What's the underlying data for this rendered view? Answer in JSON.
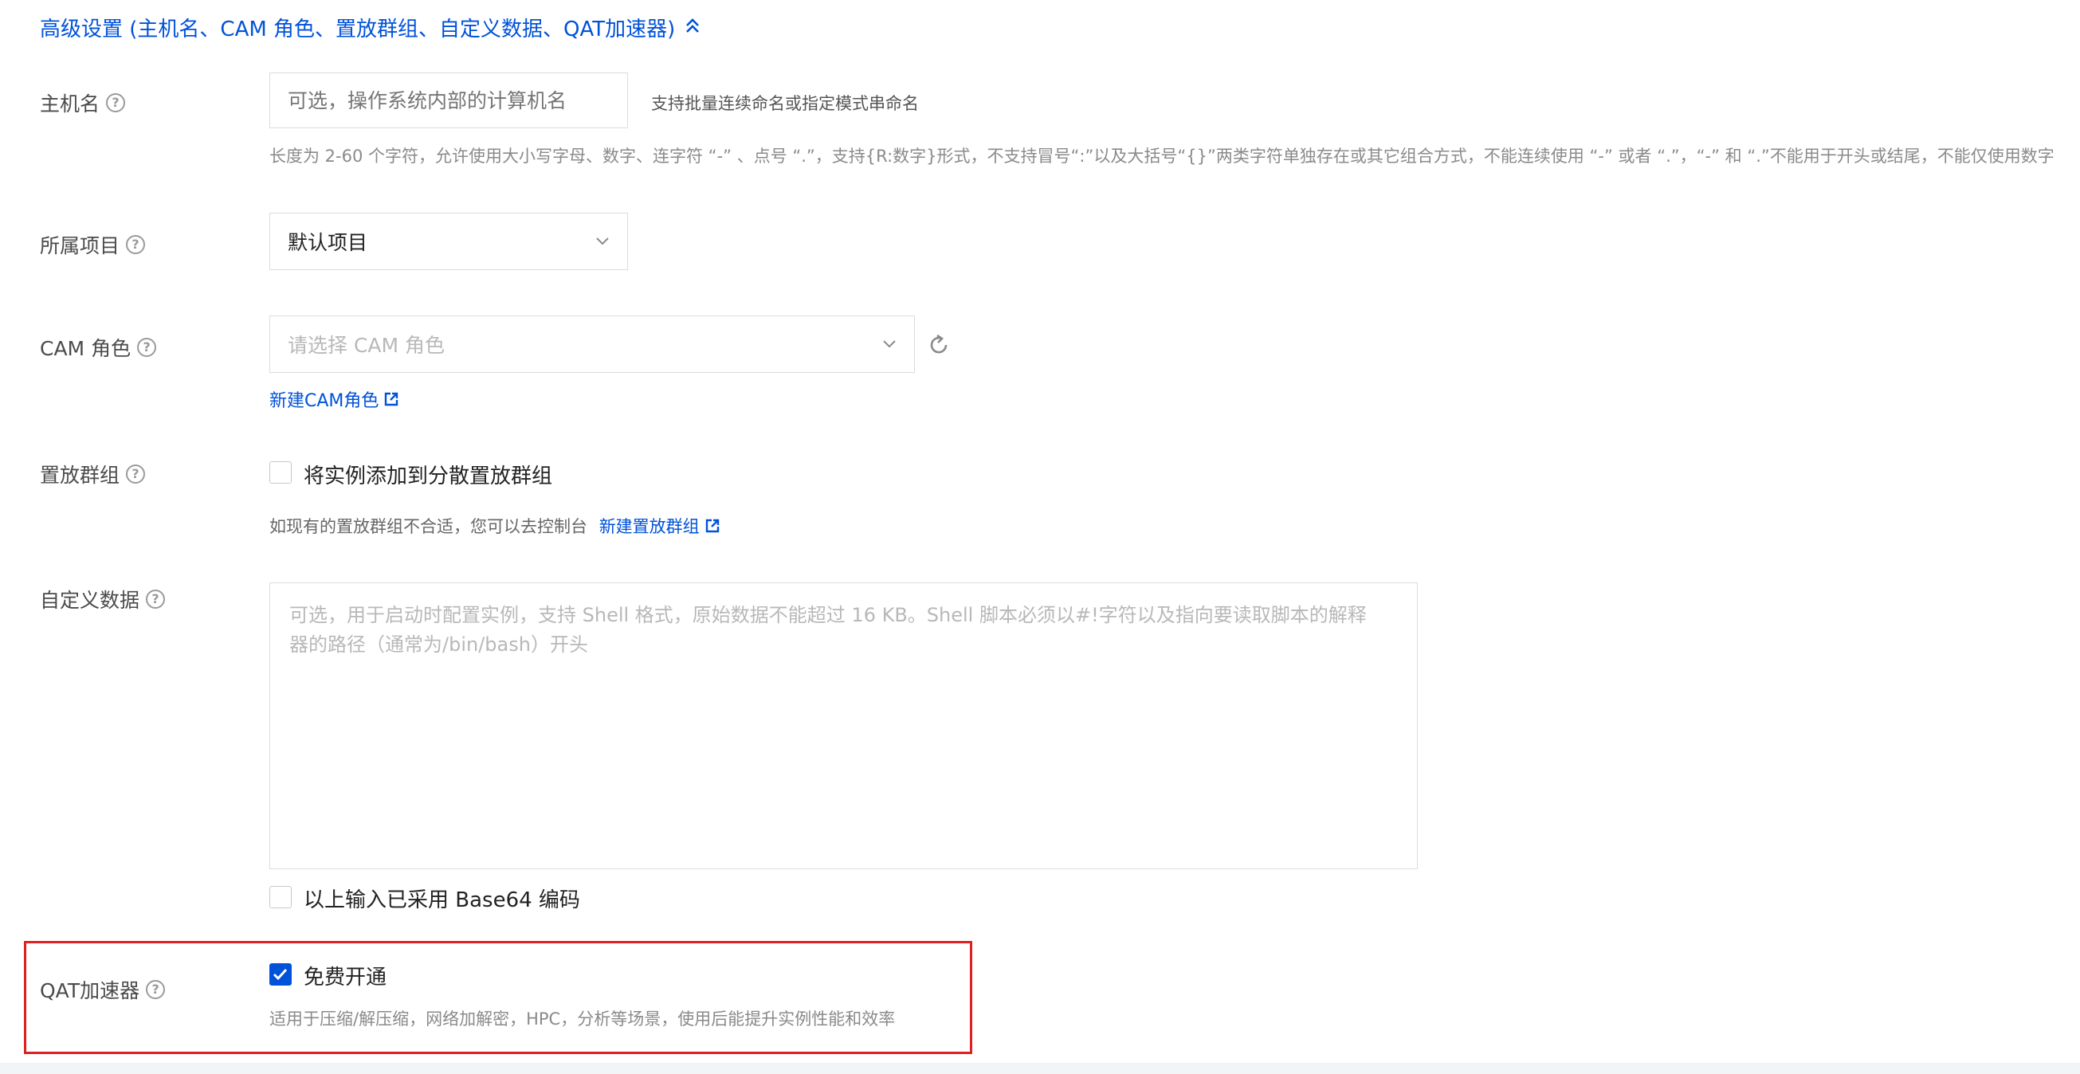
{
  "header": {
    "toggle_label": "高级设置 (主机名、CAM 角色、置放群组、自定义数据、QAT加速器)"
  },
  "hostname": {
    "label": "主机名",
    "placeholder": "可选，操作系统内部的计算机名",
    "side_hint": "支持批量连续命名或指定模式串命名",
    "rule_hint": "长度为 2-60 个字符，允许使用大小写字母、数字、连字符 “-” 、点号 “.”，支持{R:数字}形式，不支持冒号“:”以及大括号“{}”两类字符单独存在或其它组合方式，不能连续使用 “-” 或者 “.”，“-” 和 “.”不能用于开头或结尾，不能仅使用数字"
  },
  "project": {
    "label": "所属项目",
    "selected": "默认项目"
  },
  "cam_role": {
    "label": "CAM 角色",
    "placeholder": "请选择 CAM 角色",
    "create_link": "新建CAM角色"
  },
  "placement_group": {
    "label": "置放群组",
    "checkbox_label": "将实例添加到分散置放群组",
    "hint_prefix": "如现有的置放群组不合适，您可以去控制台",
    "create_link": "新建置放群组"
  },
  "user_data": {
    "label": "自定义数据",
    "placeholder_line1": "可选，用于启动时配置实例，支持 Shell 格式，原始数据不能超过 16 KB。Shell 脚本必须以#!字符以及指向要读取脚本的解释",
    "placeholder_line2": "器的路径（通常为/bin/bash）开头",
    "base64_label": "以上输入已采用 Base64 编码"
  },
  "qat": {
    "label": "QAT加速器",
    "checkbox_label": "免费开通",
    "checked": true,
    "hint": "适用于压缩/解压缩，网络加解密，HPC，分析等场景，使用后能提升实例性能和效率"
  },
  "colors": {
    "accent": "#0052d9",
    "highlight_border": "#e02020",
    "label_text": "#4b4b4b",
    "hint_text": "#8a8a8a"
  }
}
